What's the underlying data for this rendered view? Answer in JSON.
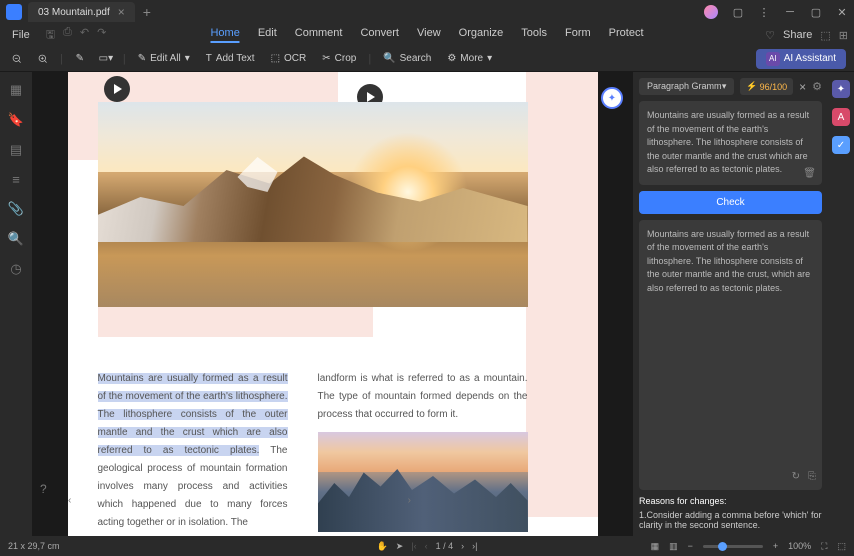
{
  "titlebar": {
    "tab_name": "03 Mountain.pdf"
  },
  "menubar": {
    "file": "File",
    "items": [
      "Home",
      "Edit",
      "Comment",
      "Convert",
      "View",
      "Organize",
      "Tools",
      "Form",
      "Protect"
    ],
    "active": 0,
    "share": "Share"
  },
  "toolbar": {
    "edit_all": "Edit All",
    "add_text": "Add Text",
    "ocr": "OCR",
    "crop": "Crop",
    "search": "Search",
    "more": "More",
    "ai": "AI Assistant"
  },
  "document": {
    "highlighted_text": "Mountains are usually formed as a result of the movement of the earth's lithosphere. The lithosphere consists of the outer mantle and the crust which are also referred to as tectonic plates.",
    "col1_rest": " The geological process of mountain formation involves many process and activities which happened due to many forces acting together or in isolation. The",
    "col2": "landform is what is referred to as a mountain. The type of mountain formed depends on the process that occurred to form it."
  },
  "ai_panel": {
    "mode": "Paragraph Gramm",
    "score": "96/100",
    "input_text": "Mountains are usually formed as a result of the movement of the earth's lithosphere. The lithosphere consists of the outer mantle and the crust which are also referred to as tectonic plates.",
    "check": "Check",
    "output_text": "Mountains are usually formed as a result of the movement of the earth's lithosphere. The lithosphere consists of the outer mantle and the crust, which are also referred to as tectonic plates.",
    "reasons_title": "Reasons for changes:",
    "reason1": "1.Consider adding a comma before 'which' for clarity in the second sentence."
  },
  "status": {
    "page_size": "21 x 29,7 cm",
    "page_num": "1 / 4",
    "zoom": "100%"
  }
}
